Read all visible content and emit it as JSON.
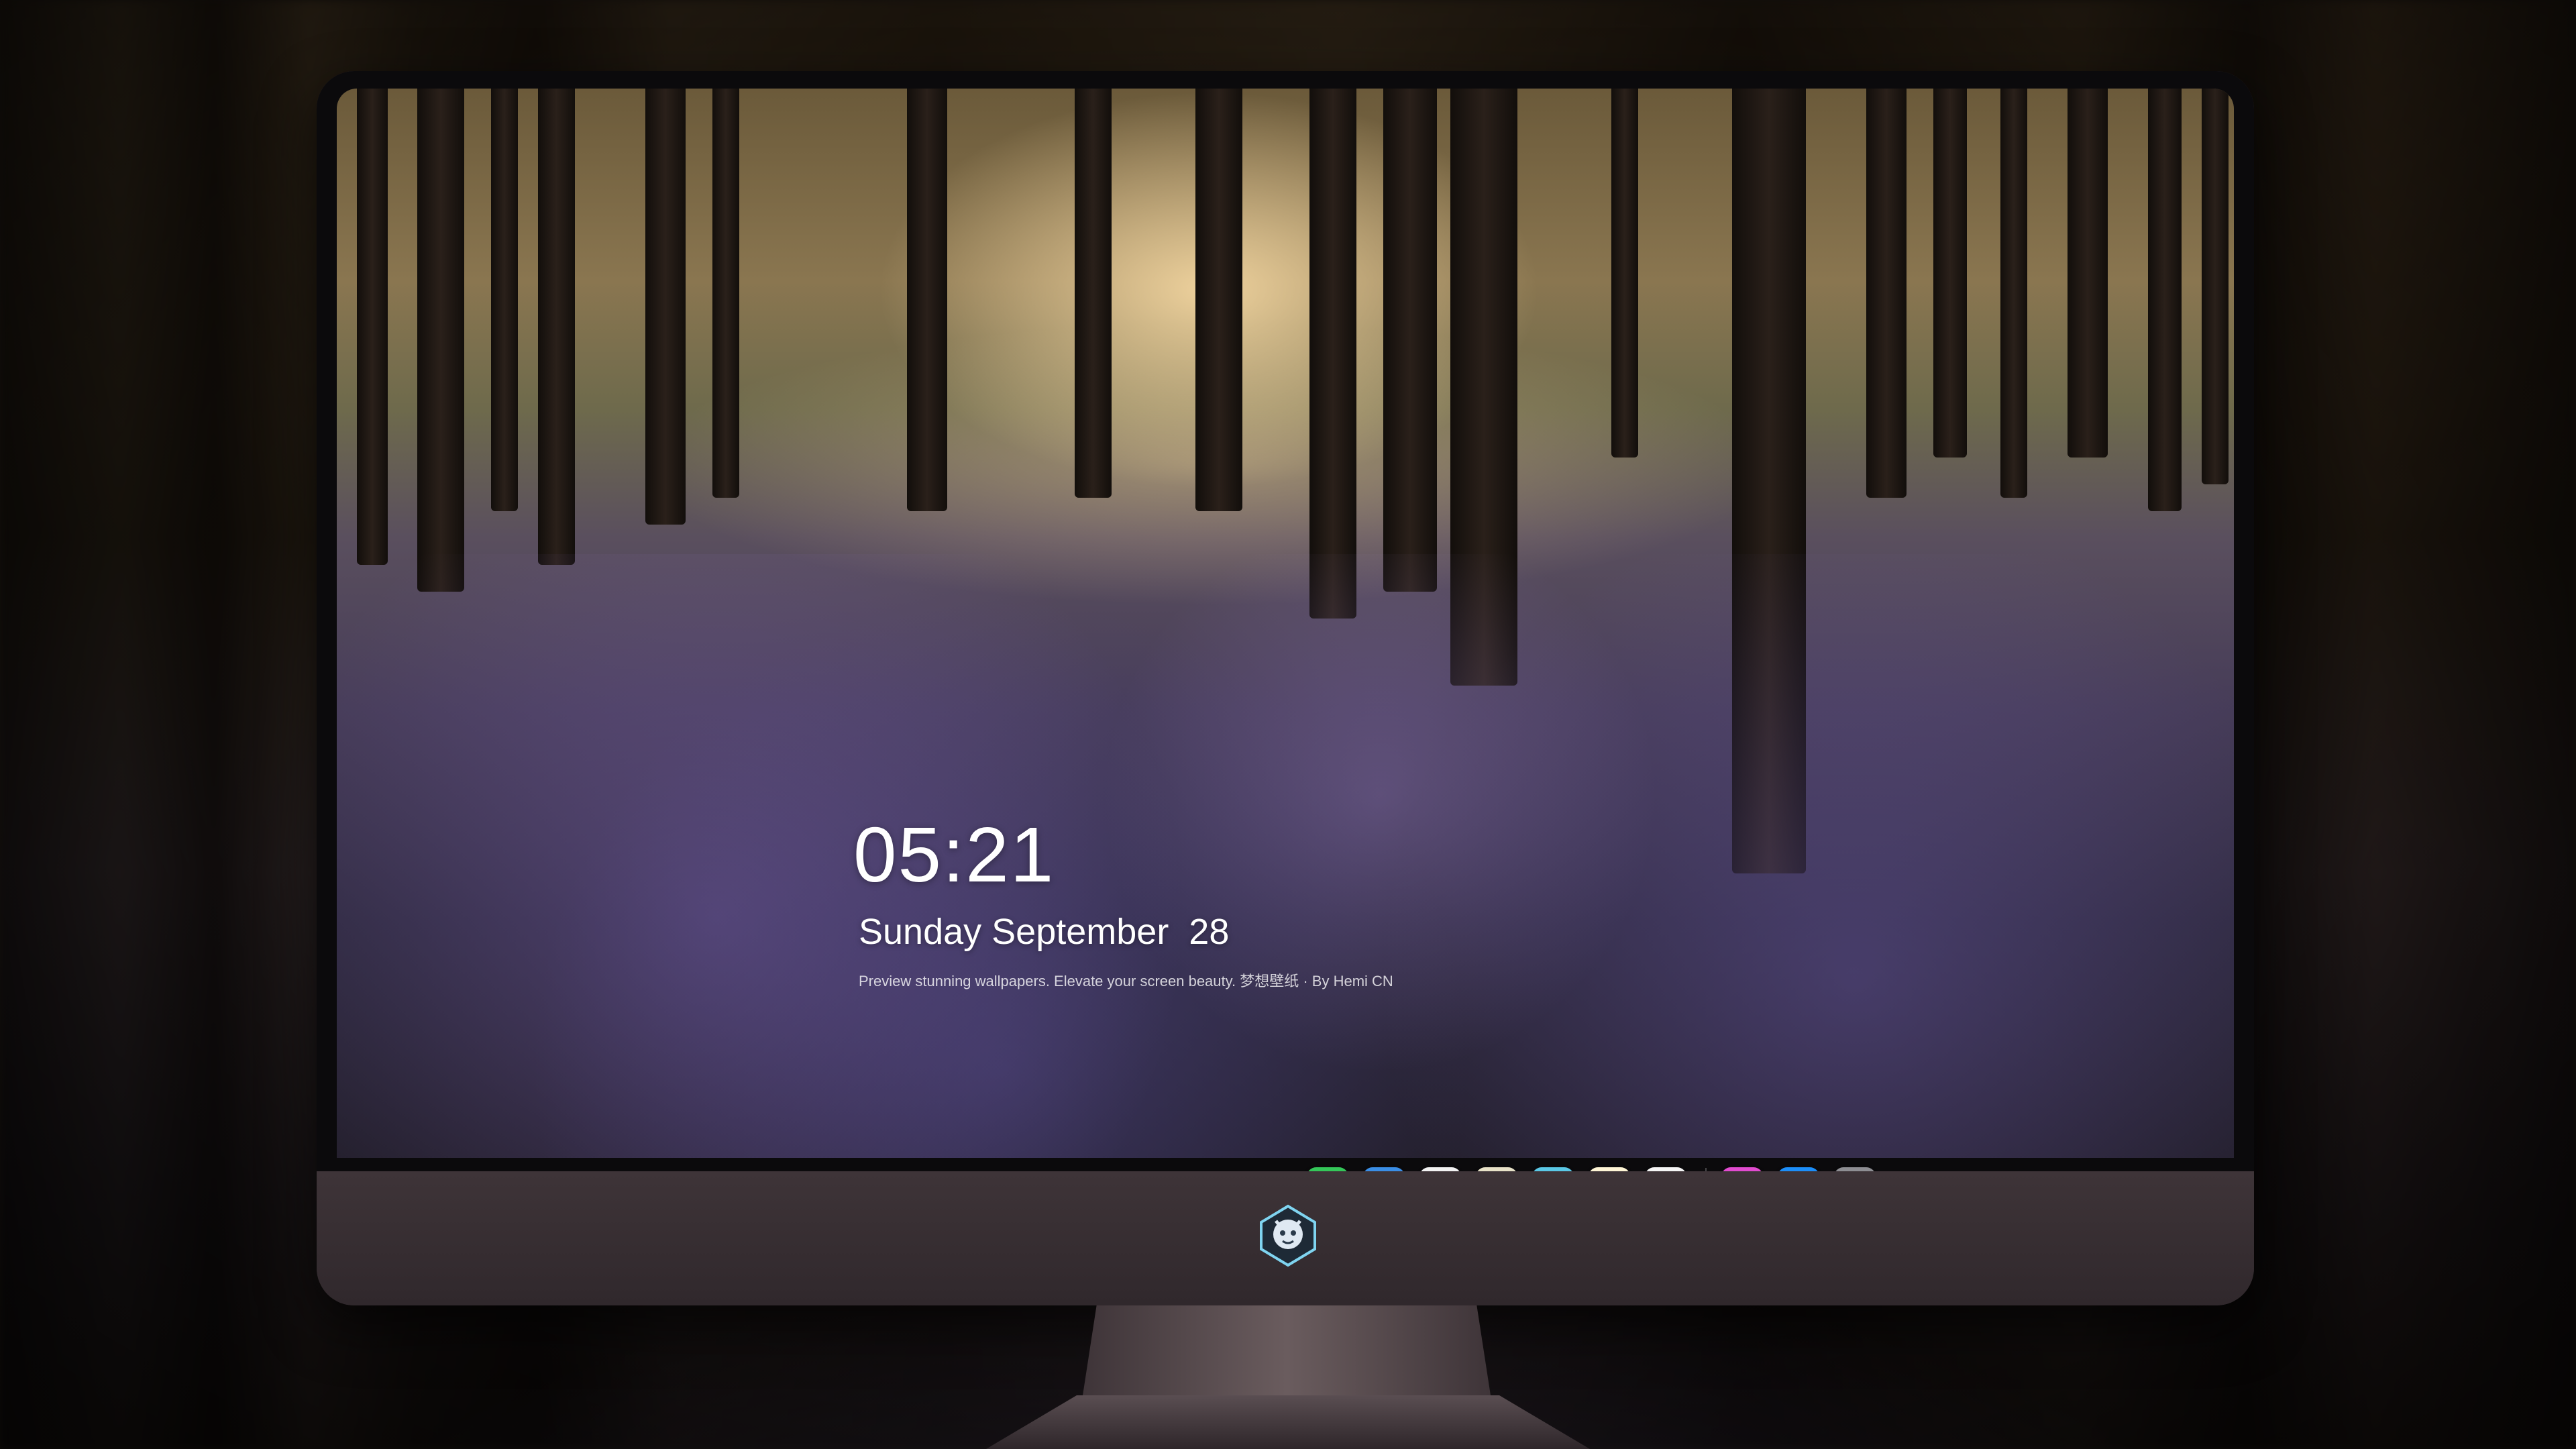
{
  "lock_screen": {
    "time": "05:21",
    "date": "Sunday September  28",
    "tagline": "Preview stunning wallpapers. Elevate your screen beauty. 梦想壁纸 · By Hemi CN"
  },
  "dock": {
    "apps": [
      {
        "name": "messages-icon",
        "bg": "#34c759",
        "glyph": "💬"
      },
      {
        "name": "weather-icon",
        "bg": "#3a8ee6",
        "glyph": "☁"
      },
      {
        "name": "clock-icon",
        "bg": "#f2f2f2",
        "glyph": "🕐"
      },
      {
        "name": "maps-icon",
        "bg": "#e8e2c8",
        "glyph": "⌖"
      },
      {
        "name": "video-icon",
        "bg": "#5ac8e6",
        "glyph": "🎬"
      },
      {
        "name": "notes-icon",
        "bg": "#fff6d6",
        "glyph": "▭"
      },
      {
        "name": "photos-icon",
        "bg": "#f5f5f5",
        "glyph": "▦"
      },
      {
        "name": "music-icon",
        "bg": "#e24bd0",
        "glyph": "♫"
      },
      {
        "name": "app-store-icon",
        "bg": "#1c8ef9",
        "glyph": "Ⓐ"
      },
      {
        "name": "camera-icon",
        "bg": "#8e8e93",
        "glyph": "📷"
      }
    ]
  },
  "colors": {
    "monitor_body": "#3a3034",
    "bezel": "#0b0a0c"
  }
}
